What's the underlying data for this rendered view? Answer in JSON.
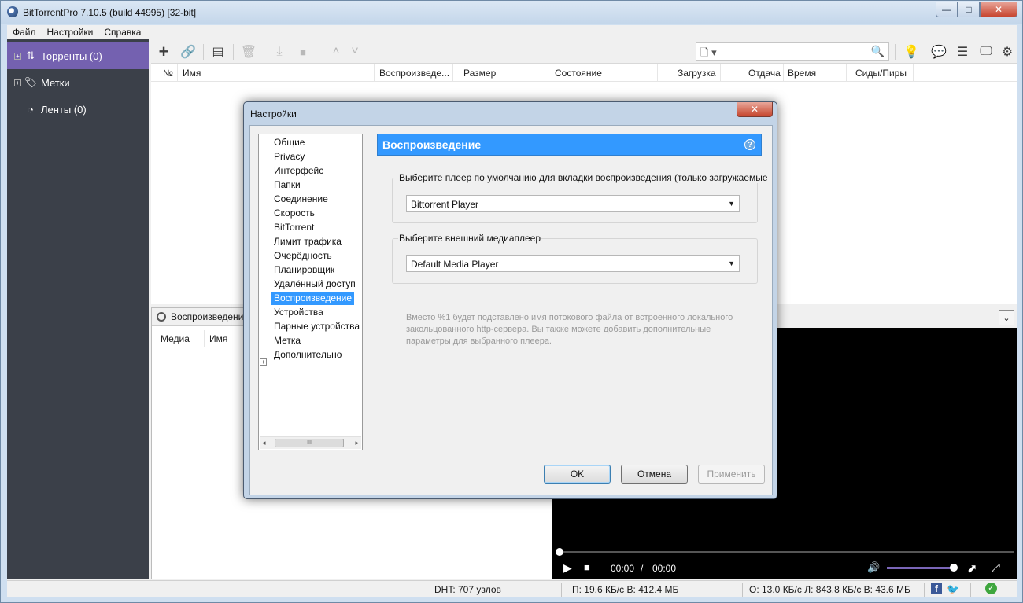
{
  "window": {
    "title": "BitTorrentPro 7.10.5  (build 44995) [32-bit]",
    "controls": {
      "minimize": "—",
      "maximize": "□",
      "close": "✕"
    }
  },
  "menu": [
    "Файл",
    "Настройки",
    "Справка"
  ],
  "sidebar": {
    "items": [
      {
        "label": "Торренты (0)",
        "icon": "torrents-arrows-icon",
        "glyph": "⇅",
        "expand": "+"
      },
      {
        "label": "Метки",
        "icon": "tag-icon",
        "glyph": "🏷",
        "expand": "+"
      },
      {
        "label": "Ленты (0)",
        "icon": "rss-icon",
        "glyph": "◔"
      }
    ],
    "active_color": "#7461b0"
  },
  "toolbar": {
    "buttons": [
      {
        "name": "add-torrent",
        "glyph": "+"
      },
      {
        "name": "add-link",
        "glyph": "🔗"
      },
      {
        "name": "create-torrent",
        "glyph": "▤"
      },
      {
        "name": "remove",
        "glyph": "🗑"
      },
      {
        "name": "download",
        "glyph": "⤓"
      },
      {
        "name": "stop",
        "glyph": "■"
      },
      {
        "name": "move-up",
        "glyph": "˄"
      },
      {
        "name": "move-down",
        "glyph": "˅"
      }
    ],
    "search": {
      "value": "",
      "placeholder": "",
      "doc_glyph": "🗋 ▾",
      "search_glyph": "🔍"
    },
    "right_icons": [
      {
        "name": "bulb",
        "glyph": "💡"
      },
      {
        "name": "chat",
        "glyph": "💬"
      },
      {
        "name": "list",
        "glyph": "☰"
      },
      {
        "name": "monitor",
        "glyph": "🖵"
      },
      {
        "name": "settings",
        "glyph": "⚙"
      }
    ]
  },
  "torrent_list": {
    "columns": [
      "№",
      "Имя",
      "Воспроизведе...",
      "Размер",
      "Состояние",
      "Загрузка",
      "Отдача",
      "Время",
      "Сиды/Пиры"
    ]
  },
  "lower": {
    "tab_label": "Воспроизведени",
    "columns": [
      "Медиа",
      "Имя"
    ],
    "collapse_glyph": "⌄"
  },
  "player": {
    "time_current": "00:00",
    "time_separator": "/",
    "time_total": "00:00",
    "play_glyph": "▶",
    "stop_glyph": "■",
    "volume_glyph": "🔊",
    "popout_glyph": "⬈",
    "fullscreen_glyph": "⤢",
    "seek_progress": 0,
    "volume_level": 1.0
  },
  "statusbar": {
    "dht": "DHT: 707 узлов",
    "download": "П: 19.6 КБ/с В: 412.4 МБ",
    "upload": "О: 13.0 КБ/с Л: 843.8 КБ/с В: 43.6 МБ",
    "facebook_glyph": "f",
    "twitter_glyph": "🐦",
    "ok_glyph": "✓"
  },
  "dialog": {
    "title": "Настройки",
    "close_glyph": "✕",
    "tree": [
      "Общие",
      "Privacy",
      "Интерфейс",
      "Папки",
      "Соединение",
      "Скорость",
      "BitTorrent",
      "Лимит трафика",
      "Очерёдность",
      "Планировщик",
      "Удалённый доступ",
      "Воспроизведение",
      "Устройства",
      "Парные устройства",
      "Метка",
      "Дополнительно"
    ],
    "tree_selected_index": 11,
    "tree_expand_glyph": "+",
    "scroll": {
      "left": "◂",
      "right": "▸",
      "thumb": "III"
    },
    "section_title": "Воспроизведение",
    "help_glyph": "?",
    "group1": {
      "label": "Выберите плеер по умолчанию для вкладки воспроизведения (только загружаемые",
      "value": "Bittorrent Player"
    },
    "group2": {
      "label": "Выберите внешний медиаплеер",
      "value": "Default Media Player"
    },
    "hint": "Вместо %1 будет подставлено имя потокового файла от встроенного локального закольцованного http-сервера. Вы также можете добавить дополнительные параметры для выбранного плеера.",
    "buttons": {
      "ok": "OK",
      "cancel": "Отмена",
      "apply": "Применить"
    },
    "select_arrow": "▼"
  }
}
